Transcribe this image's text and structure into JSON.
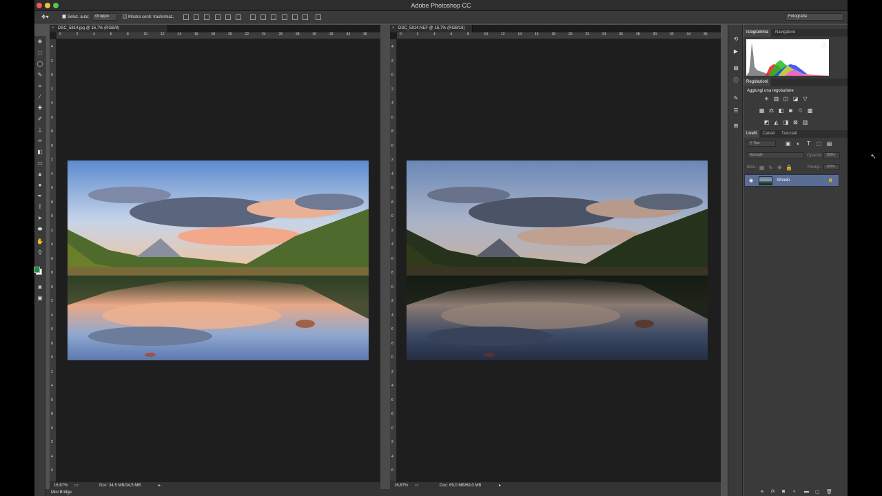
{
  "app": {
    "title": "Adobe Photoshop CC"
  },
  "options_bar": {
    "auto_select_label": "Selez. auto:",
    "auto_select_value": "Gruppo",
    "transform_label": "Mostra contr. trasformaz.",
    "workspace": "Fotografia"
  },
  "documents": [
    {
      "tab": "DSC_5814.jpg @ 16,7% (RGB/8)",
      "zoom": "16,67%",
      "doc_info": "Doc: 34,5 MB/34,5 MB"
    },
    {
      "tab": "DSC_5814.NEF @ 16,7% (RGB/16)",
      "zoom": "16,67%",
      "doc_info": "Doc: 69,0 MB/69,0 MB"
    }
  ],
  "ruler": {
    "h_ticks": [
      "0",
      "2",
      "4",
      "6",
      "8",
      "10",
      "12",
      "14",
      "16",
      "18",
      "20",
      "22",
      "24",
      "26",
      "28",
      "30",
      "32",
      "34",
      "36"
    ],
    "v_ticks": [
      "4",
      "2",
      "0",
      "2",
      "4",
      "6",
      "8",
      "0",
      "2",
      "4",
      "6",
      "8",
      "0",
      "2",
      "4",
      "6",
      "8",
      "0",
      "2",
      "4",
      "6",
      "8",
      "0",
      "2",
      "4",
      "6",
      "8",
      "0",
      "2",
      "4",
      "6"
    ]
  },
  "panels": {
    "histogram_tab": "Istogramma",
    "navigator_tab": "Navigatore",
    "adjustments_tab": "Regolazioni",
    "add_adjustment": "Aggiungi una regolazione",
    "layers_tab": "Livelli",
    "channels_tab": "Canali",
    "paths_tab": "Tracciati",
    "filter_kind": "Tipo",
    "blend_mode": "Normale",
    "opacity_label": "Opacità:",
    "opacity_value": "100%",
    "lock_label": "Bloc.:",
    "fill_label": "Riemp.:",
    "fill_value": "100%",
    "layer_name": "Sfondo"
  },
  "mini_bridge": "Mini Bridge",
  "colors": {
    "foreground": "#1a8f3a",
    "background": "#ffffff",
    "layer_highlight": "#5a6e94"
  }
}
